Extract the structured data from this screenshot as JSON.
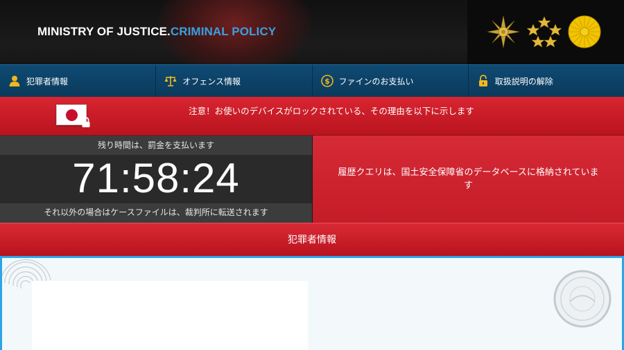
{
  "header": {
    "title_main": "MINISTRY OF JUSTICE.",
    "title_accent": "CRIMINAL POLICY",
    "emblems": [
      "police-emblem-icon",
      "rank-stars-icon",
      "chrysanthemum-seal-icon"
    ]
  },
  "nav": {
    "items": [
      {
        "label": "犯罪者情報",
        "icon": "person-icon"
      },
      {
        "label": "オフェンス情報",
        "icon": "scales-icon"
      },
      {
        "label": "ファインのお支払い",
        "icon": "dollar-coin-icon"
      },
      {
        "label": "取扱説明の解除",
        "icon": "padlock-icon"
      }
    ]
  },
  "alert": {
    "text": "注意！お使いのデバイスがロックされている、その理由を以下に示します",
    "icon": "japan-flag-lock-icon"
  },
  "timer": {
    "top_label": "残り時間は、罰金を支払います",
    "value": "71:58:24",
    "bottom_label": "それ以外の場合はケースファイルは、裁判所に転送されます"
  },
  "history": {
    "text": "履歴クエリは、国土安全保障省のデータベースに格納されています"
  },
  "section": {
    "title": "犯罪者情報"
  },
  "colors": {
    "alert_red": "#c81c28",
    "nav_blue": "#0d4468",
    "accent_blue": "#3aa0e0",
    "content_border": "#2aa6e6"
  }
}
